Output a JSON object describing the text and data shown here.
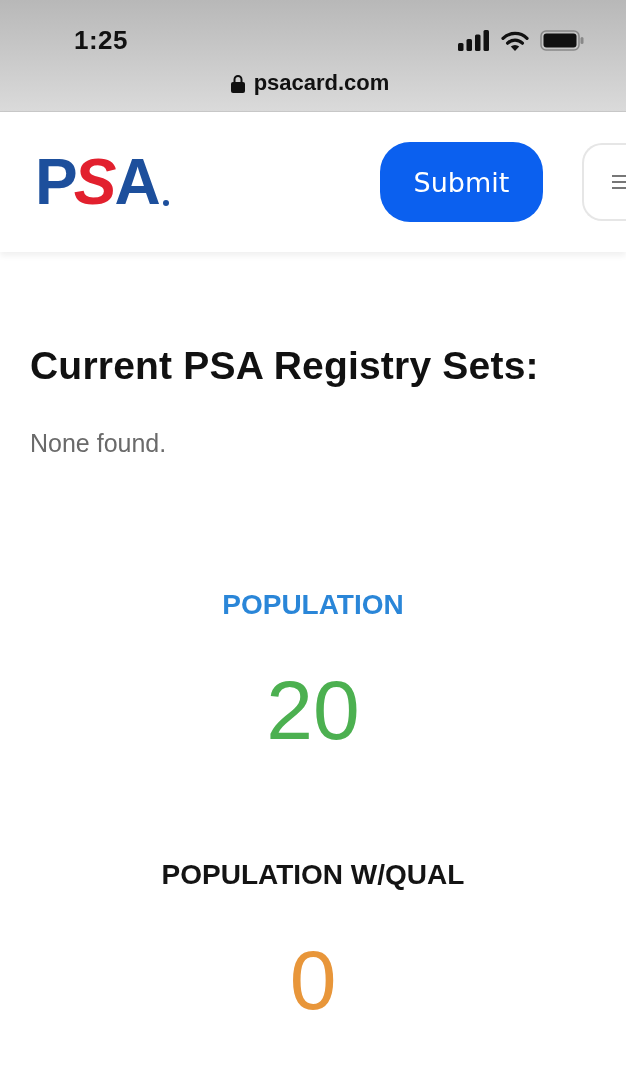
{
  "status_bar": {
    "time": "1:25"
  },
  "address_bar": {
    "url": "psacard.com"
  },
  "header": {
    "logo": "PSA",
    "buttons": [
      {
        "kind": "primary",
        "label": "Submit"
      },
      {
        "kind": "menu"
      }
    ]
  },
  "registry": {
    "title": "Current PSA Registry Sets:",
    "message": "None found."
  },
  "stats": [
    {
      "label": {
        "text": "POPULATION",
        "color": "#2a86d8"
      },
      "value": {
        "text": "20",
        "color": "#4cb050"
      }
    },
    {
      "label": {
        "text": "POPULATION W/QUAL",
        "color": "#141414"
      },
      "value": {
        "text": "0",
        "color": "#e8963a"
      }
    }
  ]
}
